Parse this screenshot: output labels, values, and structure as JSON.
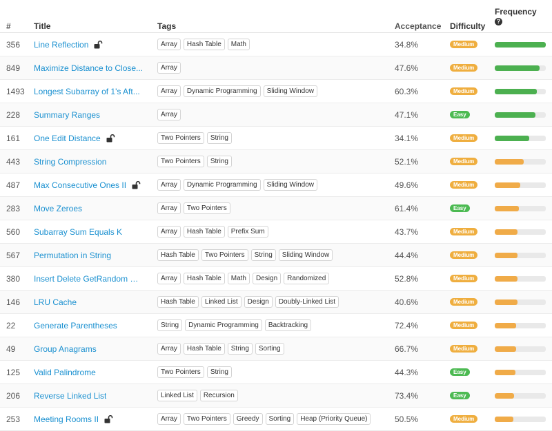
{
  "headers": {
    "num": "#",
    "title": "Title",
    "tags": "Tags",
    "acceptance": "Acceptance",
    "difficulty": "Difficulty",
    "frequency": "Frequency"
  },
  "colors": {
    "medium": "#efae3f",
    "easy": "#4cba52",
    "freq_high": "#4cb050",
    "freq_mid": "#f0ab48",
    "link": "#1a90d0"
  },
  "rows": [
    {
      "num": "356",
      "title": "Line Reflection",
      "locked": true,
      "tags": [
        "Array",
        "Hash Table",
        "Math"
      ],
      "acceptance": "34.8%",
      "difficulty": "Medium",
      "frequency": 1.0
    },
    {
      "num": "849",
      "title": "Maximize Distance to Close...",
      "locked": false,
      "tags": [
        "Array"
      ],
      "acceptance": "47.6%",
      "difficulty": "Medium",
      "frequency": 0.88
    },
    {
      "num": "1493",
      "title": "Longest Subarray of 1's Aft...",
      "locked": false,
      "tags": [
        "Array",
        "Dynamic Programming",
        "Sliding Window"
      ],
      "acceptance": "60.3%",
      "difficulty": "Medium",
      "frequency": 0.82
    },
    {
      "num": "228",
      "title": "Summary Ranges",
      "locked": false,
      "tags": [
        "Array"
      ],
      "acceptance": "47.1%",
      "difficulty": "Easy",
      "frequency": 0.8
    },
    {
      "num": "161",
      "title": "One Edit Distance",
      "locked": true,
      "tags": [
        "Two Pointers",
        "String"
      ],
      "acceptance": "34.1%",
      "difficulty": "Medium",
      "frequency": 0.68
    },
    {
      "num": "443",
      "title": "String Compression",
      "locked": false,
      "tags": [
        "Two Pointers",
        "String"
      ],
      "acceptance": "52.1%",
      "difficulty": "Medium",
      "frequency": 0.57
    },
    {
      "num": "487",
      "title": "Max Consecutive Ones II",
      "locked": true,
      "tags": [
        "Array",
        "Dynamic Programming",
        "Sliding Window"
      ],
      "acceptance": "49.6%",
      "difficulty": "Medium",
      "frequency": 0.5
    },
    {
      "num": "283",
      "title": "Move Zeroes",
      "locked": false,
      "tags": [
        "Array",
        "Two Pointers"
      ],
      "acceptance": "61.4%",
      "difficulty": "Easy",
      "frequency": 0.47
    },
    {
      "num": "560",
      "title": "Subarray Sum Equals K",
      "locked": false,
      "tags": [
        "Array",
        "Hash Table",
        "Prefix Sum"
      ],
      "acceptance": "43.7%",
      "difficulty": "Medium",
      "frequency": 0.45
    },
    {
      "num": "567",
      "title": "Permutation in String",
      "locked": false,
      "tags": [
        "Hash Table",
        "Two Pointers",
        "String",
        "Sliding Window"
      ],
      "acceptance": "44.4%",
      "difficulty": "Medium",
      "frequency": 0.45
    },
    {
      "num": "380",
      "title": "Insert Delete GetRandom O(...",
      "locked": false,
      "tags": [
        "Array",
        "Hash Table",
        "Math",
        "Design",
        "Randomized"
      ],
      "acceptance": "52.8%",
      "difficulty": "Medium",
      "frequency": 0.44
    },
    {
      "num": "146",
      "title": "LRU Cache",
      "locked": false,
      "tags": [
        "Hash Table",
        "Linked List",
        "Design",
        "Doubly-Linked List"
      ],
      "acceptance": "40.6%",
      "difficulty": "Medium",
      "frequency": 0.44
    },
    {
      "num": "22",
      "title": "Generate Parentheses",
      "locked": false,
      "tags": [
        "String",
        "Dynamic Programming",
        "Backtracking"
      ],
      "acceptance": "72.4%",
      "difficulty": "Medium",
      "frequency": 0.42
    },
    {
      "num": "49",
      "title": "Group Anagrams",
      "locked": false,
      "tags": [
        "Array",
        "Hash Table",
        "String",
        "Sorting"
      ],
      "acceptance": "66.7%",
      "difficulty": "Medium",
      "frequency": 0.42
    },
    {
      "num": "125",
      "title": "Valid Palindrome",
      "locked": false,
      "tags": [
        "Two Pointers",
        "String"
      ],
      "acceptance": "44.3%",
      "difficulty": "Easy",
      "frequency": 0.41
    },
    {
      "num": "206",
      "title": "Reverse Linked List",
      "locked": false,
      "tags": [
        "Linked List",
        "Recursion"
      ],
      "acceptance": "73.4%",
      "difficulty": "Easy",
      "frequency": 0.38
    },
    {
      "num": "253",
      "title": "Meeting Rooms II",
      "locked": true,
      "tags": [
        "Array",
        "Two Pointers",
        "Greedy",
        "Sorting",
        "Heap (Priority Queue)"
      ],
      "acceptance": "50.5%",
      "difficulty": "Medium",
      "frequency": 0.36
    }
  ]
}
